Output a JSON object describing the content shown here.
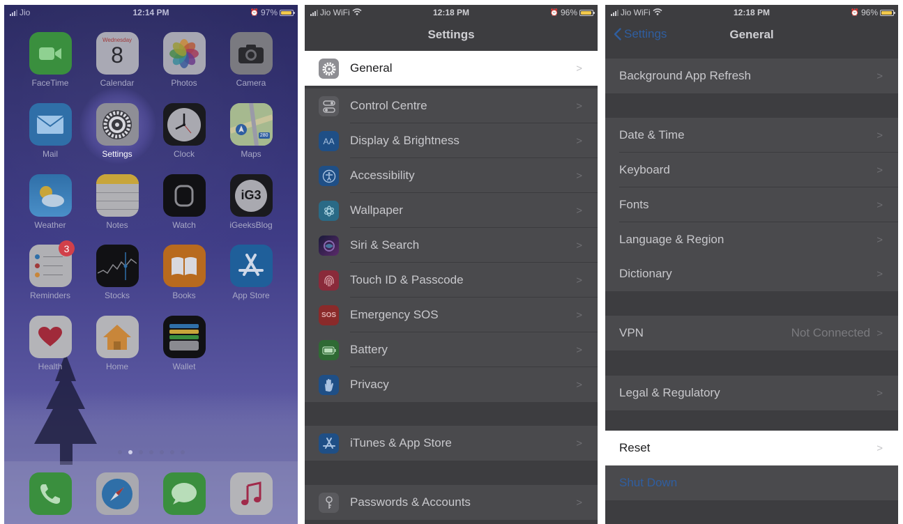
{
  "home": {
    "status": {
      "carrier": "Jio",
      "time": "12:14 PM",
      "battery": "97%"
    },
    "apps": [
      {
        "name": "FaceTime",
        "icon": "facetime-icon"
      },
      {
        "name": "Calendar",
        "icon": "calendar-icon",
        "day": "Wednesday",
        "date": "8"
      },
      {
        "name": "Photos",
        "icon": "photos-icon"
      },
      {
        "name": "Camera",
        "icon": "camera-icon"
      },
      {
        "name": "Mail",
        "icon": "mail-icon"
      },
      {
        "name": "Settings",
        "icon": "settings-gear-icon"
      },
      {
        "name": "Clock",
        "icon": "clock-icon"
      },
      {
        "name": "Maps",
        "icon": "maps-icon",
        "shield": "280"
      },
      {
        "name": "Weather",
        "icon": "weather-icon"
      },
      {
        "name": "Notes",
        "icon": "notes-icon"
      },
      {
        "name": "Watch",
        "icon": "watch-icon"
      },
      {
        "name": "iGeeksBlog",
        "icon": "igeeksblog-icon",
        "glyph": "iG3"
      },
      {
        "name": "Reminders",
        "icon": "reminders-icon",
        "badge": "3"
      },
      {
        "name": "Stocks",
        "icon": "stocks-icon"
      },
      {
        "name": "Books",
        "icon": "books-icon"
      },
      {
        "name": "App Store",
        "icon": "app-store-icon"
      },
      {
        "name": "Health",
        "icon": "health-icon"
      },
      {
        "name": "Home",
        "icon": "home-icon"
      },
      {
        "name": "Wallet",
        "icon": "wallet-icon"
      }
    ],
    "dock": [
      {
        "icon": "phone-icon"
      },
      {
        "icon": "safari-icon"
      },
      {
        "icon": "messages-icon"
      },
      {
        "icon": "music-icon"
      }
    ]
  },
  "settings": {
    "status": {
      "carrier": "Jio WiFi",
      "time": "12:18 PM",
      "battery": "96%"
    },
    "title": "Settings",
    "rows": [
      {
        "label": "General",
        "icon": "gear-icon"
      },
      {
        "label": "Control Centre",
        "icon": "control-centre-icon"
      },
      {
        "label": "Display & Brightness",
        "icon": "display-brightness-icon",
        "glyph": "AA"
      },
      {
        "label": "Accessibility",
        "icon": "accessibility-icon"
      },
      {
        "label": "Wallpaper",
        "icon": "wallpaper-icon"
      },
      {
        "label": "Siri & Search",
        "icon": "siri-icon"
      },
      {
        "label": "Touch ID & Passcode",
        "icon": "fingerprint-icon"
      },
      {
        "label": "Emergency SOS",
        "icon": "sos-icon",
        "glyph": "SOS"
      },
      {
        "label": "Battery",
        "icon": "battery-icon"
      },
      {
        "label": "Privacy",
        "icon": "hand-icon"
      },
      {
        "label": "iTunes & App Store",
        "icon": "app-store-icon"
      },
      {
        "label": "Passwords & Accounts",
        "icon": "key-icon"
      }
    ]
  },
  "general": {
    "status": {
      "carrier": "Jio WiFi",
      "time": "12:18 PM",
      "battery": "96%"
    },
    "back": "Settings",
    "title": "General",
    "rows": [
      {
        "label": "Background App Refresh"
      },
      {
        "label": "Date & Time"
      },
      {
        "label": "Keyboard"
      },
      {
        "label": "Fonts"
      },
      {
        "label": "Language & Region"
      },
      {
        "label": "Dictionary"
      },
      {
        "label": "VPN",
        "value": "Not Connected"
      },
      {
        "label": "Legal & Regulatory"
      },
      {
        "label": "Reset"
      },
      {
        "label": "Shut Down"
      }
    ]
  },
  "colors": {
    "highlight_row": "#ffffff",
    "ios_blue": "#2f5ea0",
    "dim_overlay": "#3d3d40"
  }
}
